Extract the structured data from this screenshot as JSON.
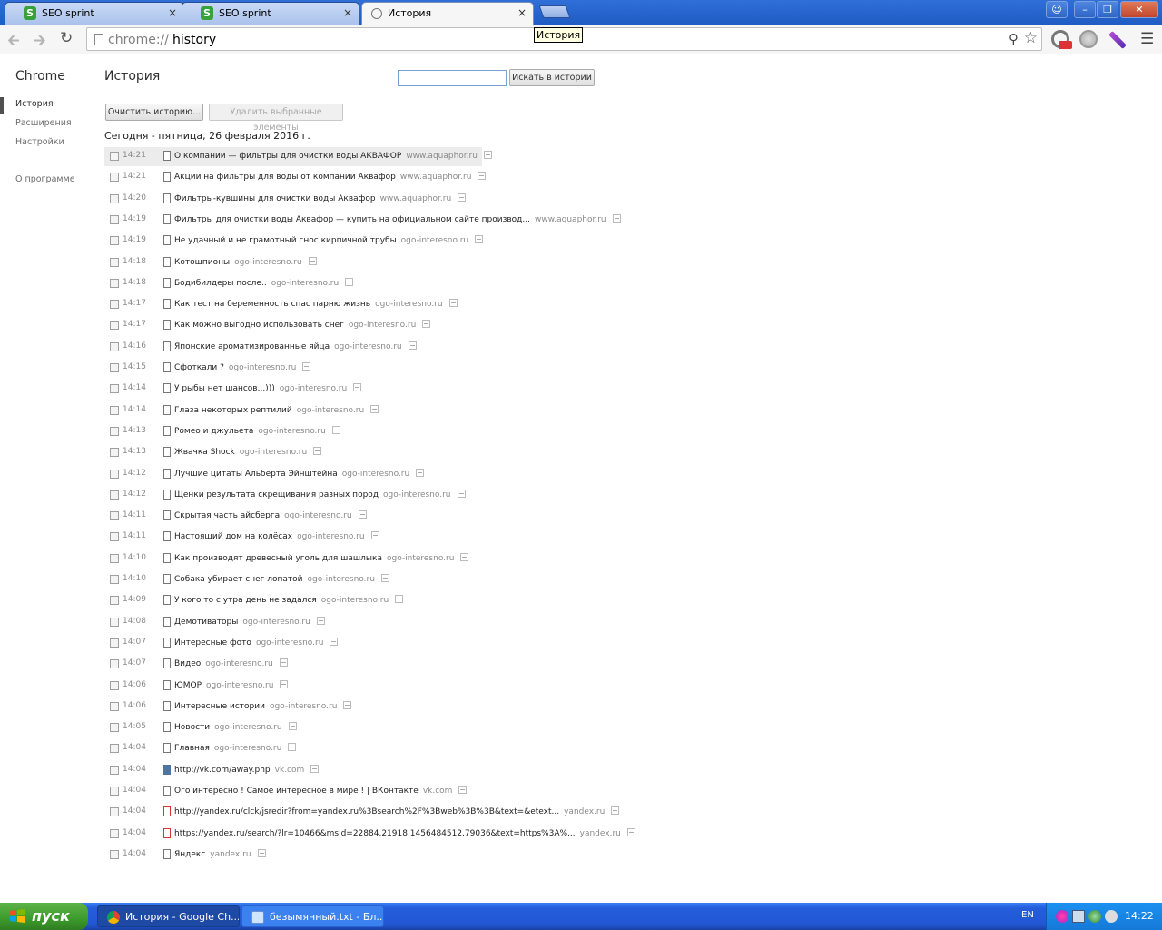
{
  "tabs": [
    {
      "title": "SEO sprint",
      "favicon": "seo-sprint-icon",
      "active": false
    },
    {
      "title": "SEO sprint",
      "favicon": "seo-sprint-icon",
      "active": false
    },
    {
      "title": "История",
      "favicon": "history-icon",
      "active": true
    }
  ],
  "tab_close_glyph": "×",
  "omnibox": {
    "scheme": "chrome://",
    "path": "history"
  },
  "tooltip": "История",
  "sidebar": {
    "app_name": "Chrome",
    "items": [
      {
        "label": "История",
        "active": true
      },
      {
        "label": "Расширения",
        "active": false
      },
      {
        "label": "Настройки",
        "active": false
      }
    ],
    "about": "О программе"
  },
  "main": {
    "title": "История",
    "search_value": "",
    "search_button": "Искать в истории",
    "clear_button": "Очистить историю...",
    "remove_button": "Удалить выбранные элементы",
    "day_header": "Сегодня - пятница, 26 февраля 2016 г."
  },
  "history": [
    {
      "time": "14:21",
      "title": "О компании — фильтры для очистки воды АКВАФОР",
      "domain": "www.aquaphor.ru",
      "favicon": "page-icon"
    },
    {
      "time": "14:21",
      "title": "Акции на фильтры для воды от компании Аквафор",
      "domain": "www.aquaphor.ru",
      "favicon": "page-icon"
    },
    {
      "time": "14:20",
      "title": "Фильтры-кувшины для очистки воды Аквафор",
      "domain": "www.aquaphor.ru",
      "favicon": "page-icon"
    },
    {
      "time": "14:19",
      "title": "Фильтры для очистки воды Аквафор — купить на официальном сайте производ...",
      "domain": "www.aquaphor.ru",
      "favicon": "page-icon"
    },
    {
      "time": "14:19",
      "title": "Не удачный и не грамотный снос кирпичной трубы",
      "domain": "ogo-interesno.ru",
      "favicon": "page-icon"
    },
    {
      "time": "14:18",
      "title": "Котошпионы",
      "domain": "ogo-interesno.ru",
      "favicon": "page-icon"
    },
    {
      "time": "14:18",
      "title": "Бодибилдеры после..",
      "domain": "ogo-interesno.ru",
      "favicon": "page-icon"
    },
    {
      "time": "14:17",
      "title": "Как тест на беременность спас парню жизнь",
      "domain": "ogo-interesno.ru",
      "favicon": "page-icon"
    },
    {
      "time": "14:17",
      "title": "Как можно выгодно использовать снег",
      "domain": "ogo-interesno.ru",
      "favicon": "page-icon"
    },
    {
      "time": "14:16",
      "title": "Японские ароматизированные яйца",
      "domain": "ogo-interesno.ru",
      "favicon": "page-icon"
    },
    {
      "time": "14:15",
      "title": "Сфоткали ?",
      "domain": "ogo-interesno.ru",
      "favicon": "page-icon"
    },
    {
      "time": "14:14",
      "title": "У рыбы нет шансов...)))",
      "domain": "ogo-interesno.ru",
      "favicon": "page-icon"
    },
    {
      "time": "14:14",
      "title": "Глаза некоторых рептилий",
      "domain": "ogo-interesno.ru",
      "favicon": "page-icon"
    },
    {
      "time": "14:13",
      "title": "Ромео и джульета",
      "domain": "ogo-interesno.ru",
      "favicon": "page-icon"
    },
    {
      "time": "14:13",
      "title": "Жвачка Shock",
      "domain": "ogo-interesno.ru",
      "favicon": "page-icon"
    },
    {
      "time": "14:12",
      "title": "Лучшие цитаты Альберта Эйнштейна",
      "domain": "ogo-interesno.ru",
      "favicon": "page-icon"
    },
    {
      "time": "14:12",
      "title": "Щенки результата скрещивания разных пород",
      "domain": "ogo-interesno.ru",
      "favicon": "page-icon"
    },
    {
      "time": "14:11",
      "title": "Скрытая часть айсберга",
      "domain": "ogo-interesno.ru",
      "favicon": "page-icon"
    },
    {
      "time": "14:11",
      "title": "Настоящий дом на колёсах",
      "domain": "ogo-interesno.ru",
      "favicon": "page-icon"
    },
    {
      "time": "14:10",
      "title": "Как производят древесный уголь для шашлыка",
      "domain": "ogo-interesno.ru",
      "favicon": "page-icon"
    },
    {
      "time": "14:10",
      "title": "Собака убирает снег лопатой",
      "domain": "ogo-interesno.ru",
      "favicon": "page-icon"
    },
    {
      "time": "14:09",
      "title": "У кого то с утра день не задался",
      "domain": "ogo-interesno.ru",
      "favicon": "page-icon"
    },
    {
      "time": "14:08",
      "title": "Демотиваторы",
      "domain": "ogo-interesno.ru",
      "favicon": "page-icon"
    },
    {
      "time": "14:07",
      "title": "Интересные фото",
      "domain": "ogo-interesno.ru",
      "favicon": "page-icon"
    },
    {
      "time": "14:07",
      "title": "Видео",
      "domain": "ogo-interesno.ru",
      "favicon": "page-icon"
    },
    {
      "time": "14:06",
      "title": "ЮМОР",
      "domain": "ogo-interesno.ru",
      "favicon": "page-icon"
    },
    {
      "time": "14:06",
      "title": "Интересные истории",
      "domain": "ogo-interesno.ru",
      "favicon": "page-icon"
    },
    {
      "time": "14:05",
      "title": "Новости",
      "domain": "ogo-interesno.ru",
      "favicon": "page-icon"
    },
    {
      "time": "14:04",
      "title": "Главная",
      "domain": "ogo-interesno.ru",
      "favicon": "page-icon"
    },
    {
      "time": "14:04",
      "title": "http://vk.com/away.php",
      "domain": "vk.com",
      "favicon": "vk-icon"
    },
    {
      "time": "14:04",
      "title": "Ого интересно ! Самое интересное в мире ! | ВКонтакте",
      "domain": "vk.com",
      "favicon": "page-icon"
    },
    {
      "time": "14:04",
      "title": "http://yandex.ru/clck/jsredir?from=yandex.ru%3Bsearch%2F%3Bweb%3B%3B&text=&etext...",
      "domain": "yandex.ru",
      "favicon": "yandex-icon"
    },
    {
      "time": "14:04",
      "title": "https://yandex.ru/search/?lr=10466&msid=22884.21918.1456484512.79036&text=https%3A%...",
      "domain": "yandex.ru",
      "favicon": "yandex-icon"
    },
    {
      "time": "14:04",
      "title": "Яндекс",
      "domain": "yandex.ru",
      "favicon": "page-icon"
    }
  ],
  "taskbar": {
    "start": "пуск",
    "tasks": [
      {
        "label": "История - Google Ch...",
        "icon": "chrome-icon",
        "active": true
      },
      {
        "label": "безымянный.txt - Бл...",
        "icon": "notepad-icon",
        "active": false
      }
    ],
    "lang": "EN",
    "clock": "14:22"
  },
  "colors": {
    "titlebar": "#2f6fd6",
    "taskbar": "#245ddb",
    "start": "#3c9a2b",
    "tray": "#1c91f0"
  }
}
